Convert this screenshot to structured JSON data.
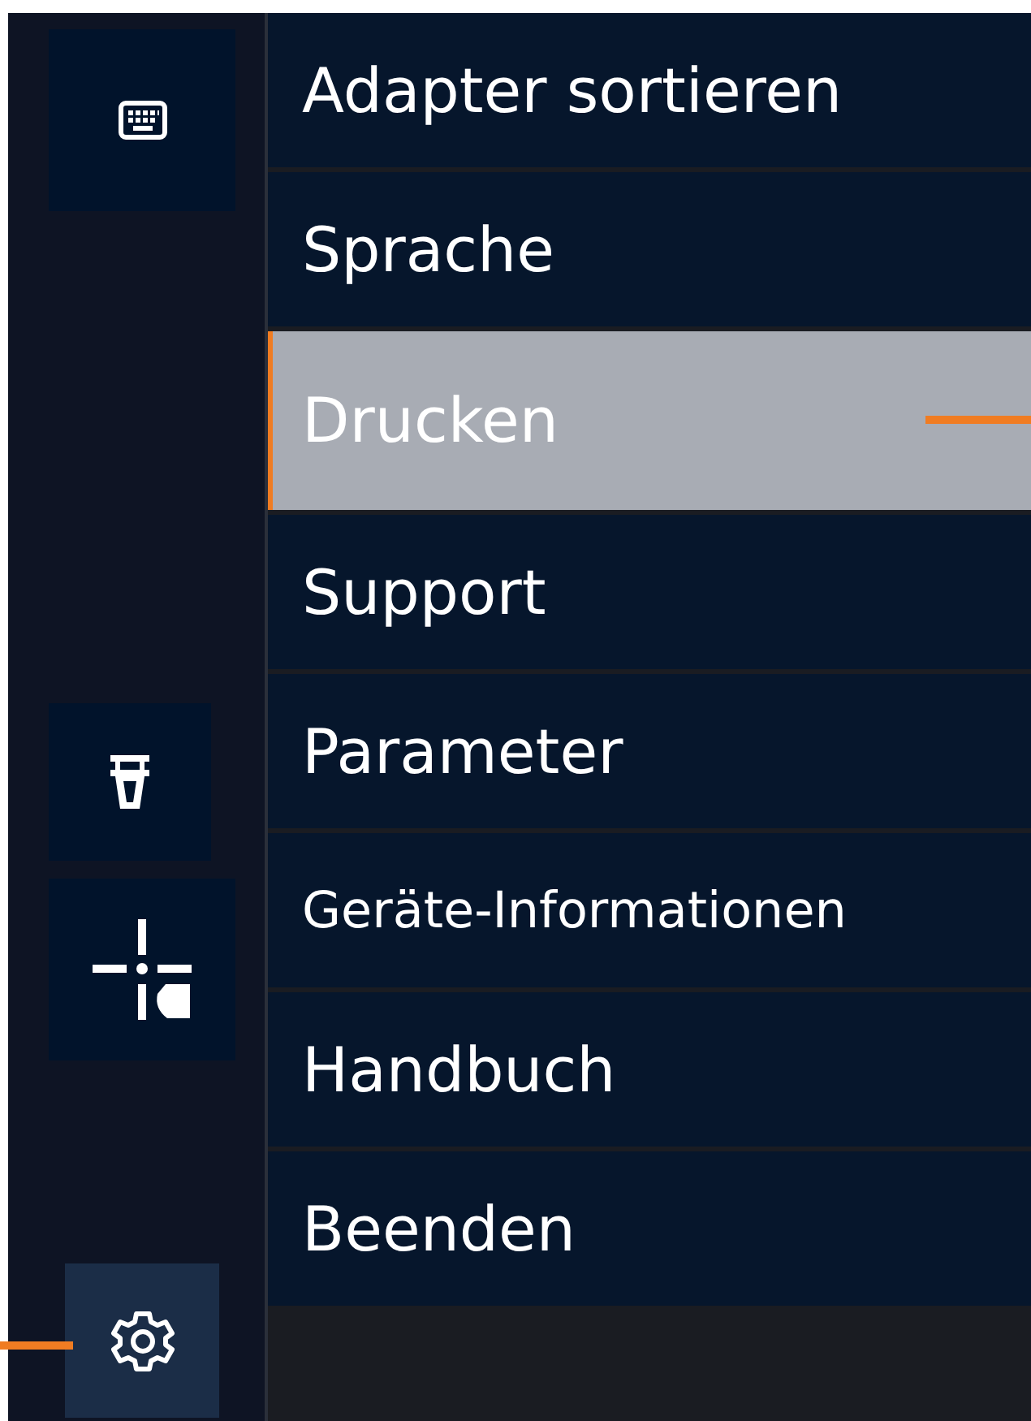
{
  "sidebar": {
    "buttons": [
      {
        "kind": "keyboard",
        "selected": false
      },
      {
        "kind": "adapter",
        "selected": false
      },
      {
        "kind": "crosshair",
        "selected": false
      },
      {
        "kind": "settings",
        "selected": true
      }
    ]
  },
  "menu": {
    "items": [
      {
        "label": "Adapter sortieren",
        "selected": false
      },
      {
        "label": "Sprache",
        "selected": false
      },
      {
        "label": "Drucken",
        "selected": true
      },
      {
        "label": "Support",
        "selected": false
      },
      {
        "label": "Parameter",
        "selected": false
      },
      {
        "label": "Geräte-Informationen",
        "selected": false
      },
      {
        "label": "Handbuch",
        "selected": false
      },
      {
        "label": "Beenden",
        "selected": false
      }
    ]
  }
}
